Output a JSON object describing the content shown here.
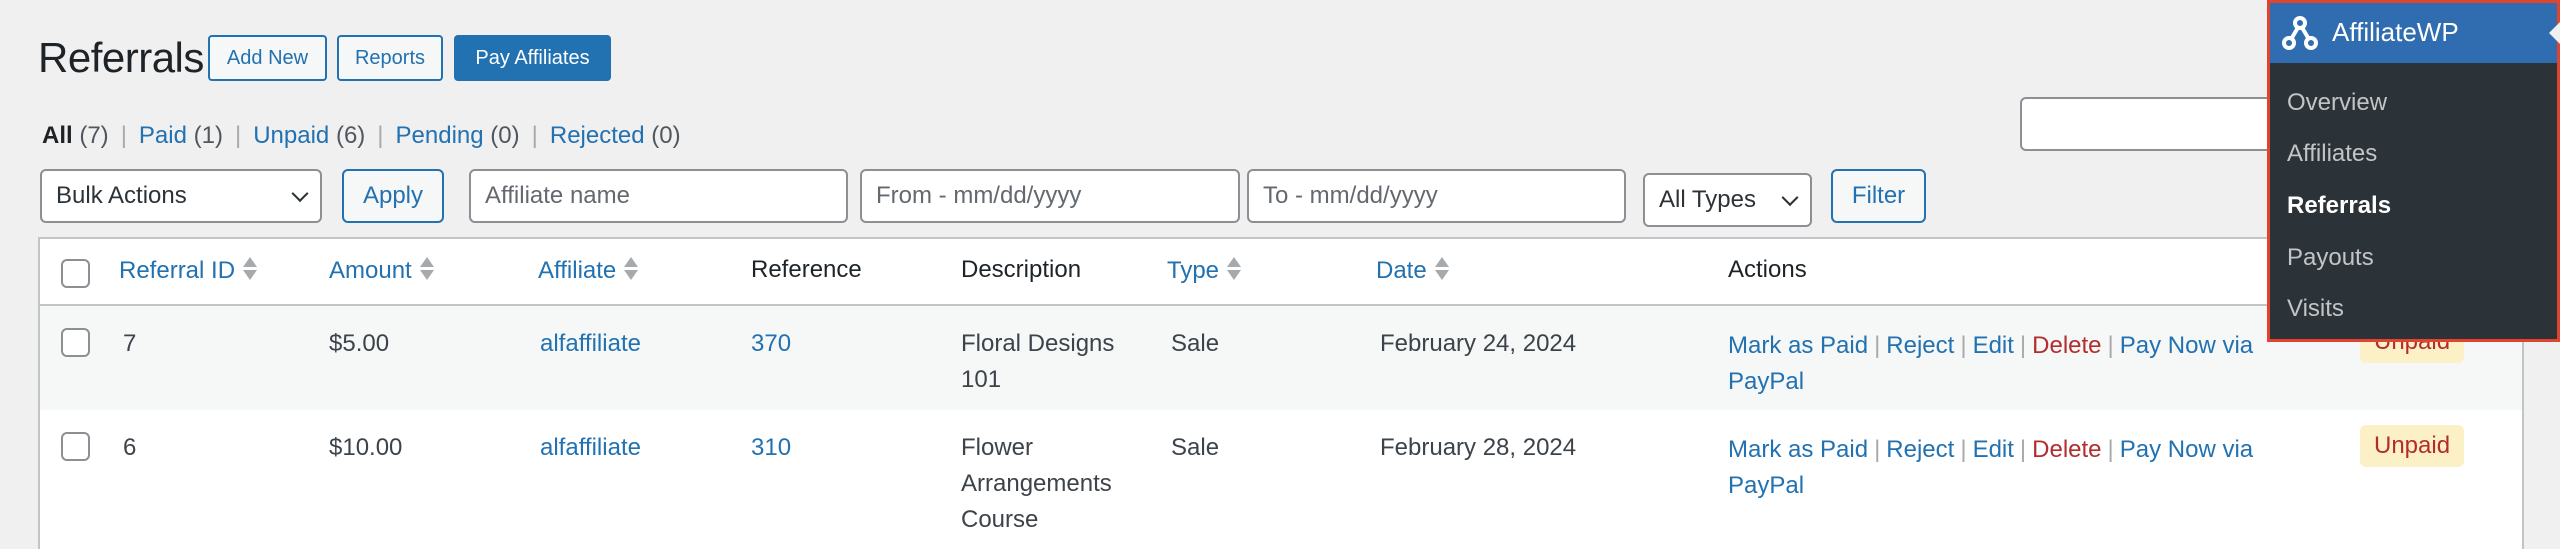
{
  "header": {
    "title": "Referrals",
    "buttons": {
      "add_new": "Add New",
      "reports": "Reports",
      "pay_affiliates": "Pay Affiliates"
    }
  },
  "status_filters": [
    {
      "label": "All",
      "count": "(7)",
      "current": true
    },
    {
      "label": "Paid",
      "count": "(1)",
      "current": false
    },
    {
      "label": "Unpaid",
      "count": "(6)",
      "current": false
    },
    {
      "label": "Pending",
      "count": "(0)",
      "current": false
    },
    {
      "label": "Rejected",
      "count": "(0)",
      "current": false
    }
  ],
  "separator": "|",
  "toolbar": {
    "bulk_actions": "Bulk Actions",
    "apply": "Apply",
    "affiliate_placeholder": "Affiliate name",
    "from_placeholder": "From - mm/dd/yyyy",
    "to_placeholder": "To - mm/dd/yyyy",
    "type_select": "All Types",
    "filter": "Filter",
    "search_value": ""
  },
  "table": {
    "columns": [
      {
        "key": "id",
        "label": "Referral ID",
        "sortable": true
      },
      {
        "key": "amount",
        "label": "Amount",
        "sortable": true
      },
      {
        "key": "affiliate",
        "label": "Affiliate",
        "sortable": true
      },
      {
        "key": "reference",
        "label": "Reference",
        "sortable": false
      },
      {
        "key": "description",
        "label": "Description",
        "sortable": false
      },
      {
        "key": "type",
        "label": "Type",
        "sortable": true
      },
      {
        "key": "date",
        "label": "Date",
        "sortable": true
      },
      {
        "key": "actions",
        "label": "Actions",
        "sortable": false
      }
    ],
    "rows": [
      {
        "id": "7",
        "amount": "$5.00",
        "affiliate": "alfaffiliate",
        "reference": "370",
        "description": "Floral Designs 101",
        "type": "Sale",
        "date": "February 24, 2024",
        "status": "Unpaid"
      },
      {
        "id": "6",
        "amount": "$10.00",
        "affiliate": "alfaffiliate",
        "reference": "310",
        "description": "Flower Arrangements Course",
        "type": "Sale",
        "date": "February 28, 2024",
        "status": "Unpaid"
      }
    ],
    "row_actions": {
      "mark_paid": "Mark as Paid",
      "reject": "Reject",
      "edit": "Edit",
      "delete": "Delete",
      "pay_now": "Pay Now via PayPal"
    }
  },
  "menu": {
    "title": "AffiliateWP",
    "logo_icon": "affiliatewp-logo-icon",
    "items": [
      {
        "label": "Overview",
        "current": false
      },
      {
        "label": "Affiliates",
        "current": false
      },
      {
        "label": "Referrals",
        "current": true
      },
      {
        "label": "Payouts",
        "current": false
      },
      {
        "label": "Visits",
        "current": false
      }
    ]
  },
  "colors": {
    "accent": "#2271b1",
    "delete": "#b32d2e",
    "unpaid_badge_bg": "#fcf0c7",
    "menu_bg": "#2c3338",
    "menu_header": "#2f6db0",
    "highlight_border": "#e0432e"
  }
}
